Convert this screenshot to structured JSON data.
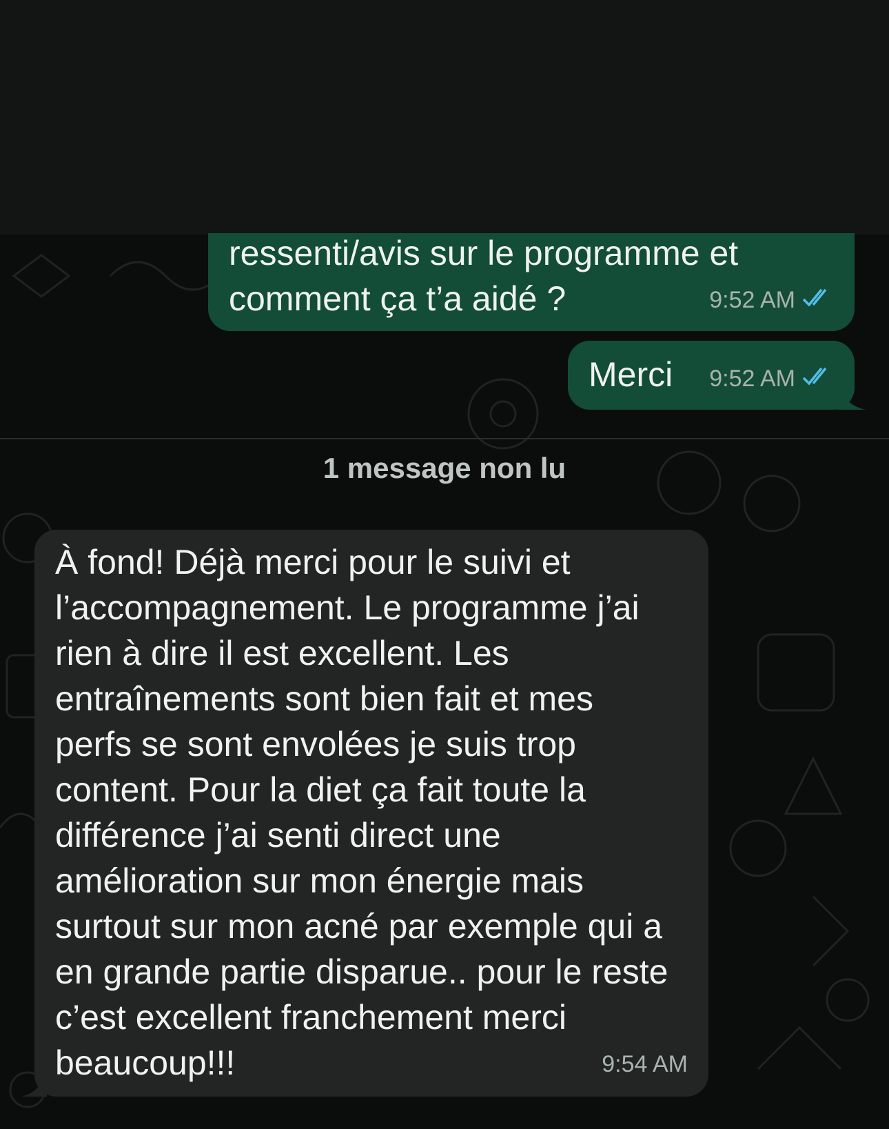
{
  "messages": {
    "out1": {
      "text": "ressenti/avis sur le programme et\ncomment ça t’a aidé ?",
      "time": "9:52 AM",
      "status": "read-double-check"
    },
    "out2": {
      "text": "Merci",
      "time": "9:52 AM",
      "status": "read-double-check"
    },
    "in1": {
      "text": "À fond! Déjà merci pour le suivi et\nl’accompagnement. Le programme j’ai\nrien à dire il est excellent. Les\nentraînements sont bien fait et mes\nperfs se sont envolées je suis trop\ncontent. Pour la diet ça fait toute la\ndifférence j’ai senti direct une\namélioration sur mon énergie mais\nsurtout sur mon acné par exemple qui a\nen grande partie disparue.. pour le reste\nc’est excellent franchement merci\nbeaucoup!!!",
      "time": "9:54 AM"
    }
  },
  "unread_label": "1 message non lu",
  "colors": {
    "outgoing_bubble": "#134d37",
    "incoming_bubble": "#222524",
    "read_ticks": "#53bdeb",
    "background": "#0b0d0c"
  }
}
